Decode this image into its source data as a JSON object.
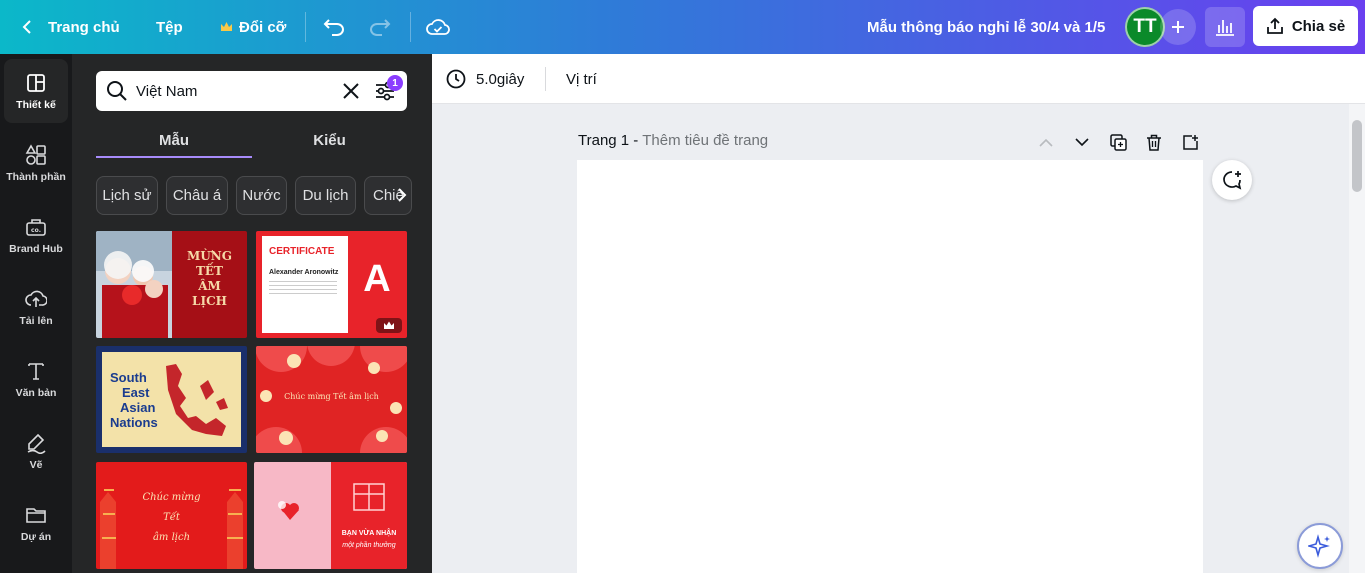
{
  "topbar": {
    "home_label": "Trang chủ",
    "file_label": "Tệp",
    "resize_label": "Đổi cỡ",
    "doc_title": "Mẫu thông báo nghỉ lễ 30/4 và 1/5",
    "avatar_initials": "TT",
    "share_label": "Chia sẻ"
  },
  "rail": {
    "items": [
      {
        "label": "Thiết kế",
        "icon": "layout-icon"
      },
      {
        "label": "Thành phần",
        "icon": "shapes-icon"
      },
      {
        "label": "Brand Hub",
        "icon": "brand-icon"
      },
      {
        "label": "Tải lên",
        "icon": "cloud-upload-icon"
      },
      {
        "label": "Văn bản",
        "icon": "text-icon"
      },
      {
        "label": "Vẽ",
        "icon": "draw-icon"
      },
      {
        "label": "Dự án",
        "icon": "folder-icon"
      }
    ]
  },
  "panel": {
    "search_value": "Việt Nam",
    "filter_count": "1",
    "tabs": [
      "Mẫu",
      "Kiểu"
    ],
    "chips": [
      "Lịch sử",
      "Châu á",
      "Nước",
      "Du lịch",
      "Chiê"
    ],
    "thumbs": {
      "t1": {
        "title_lines": [
          "MỪNG",
          "TẾT",
          "ÂM",
          "LỊCH"
        ]
      },
      "t2": {
        "heading": "CERTIFICATE",
        "name": "Alexander Aronowitz",
        "logo_letter": "A"
      },
      "t3": {
        "lines": [
          "South",
          "East",
          "Asian",
          "Nations"
        ]
      },
      "t4": {
        "text": "Chúc mừng Tết âm lịch"
      },
      "t5": {
        "lines": [
          "Chúc mừng",
          "Tết",
          "âm lịch"
        ]
      },
      "t6": {
        "lines": [
          "BẠN VỪA NHẬN",
          "một phần thưởng"
        ]
      }
    }
  },
  "toolbar": {
    "duration": "5.0giây",
    "position": "Vị trí"
  },
  "page": {
    "label": "Trang 1 -",
    "title_placeholder": "Thêm tiêu đề trang"
  },
  "colors": {
    "accent": "#8b3dff",
    "brand_red": "#e31c1c"
  }
}
